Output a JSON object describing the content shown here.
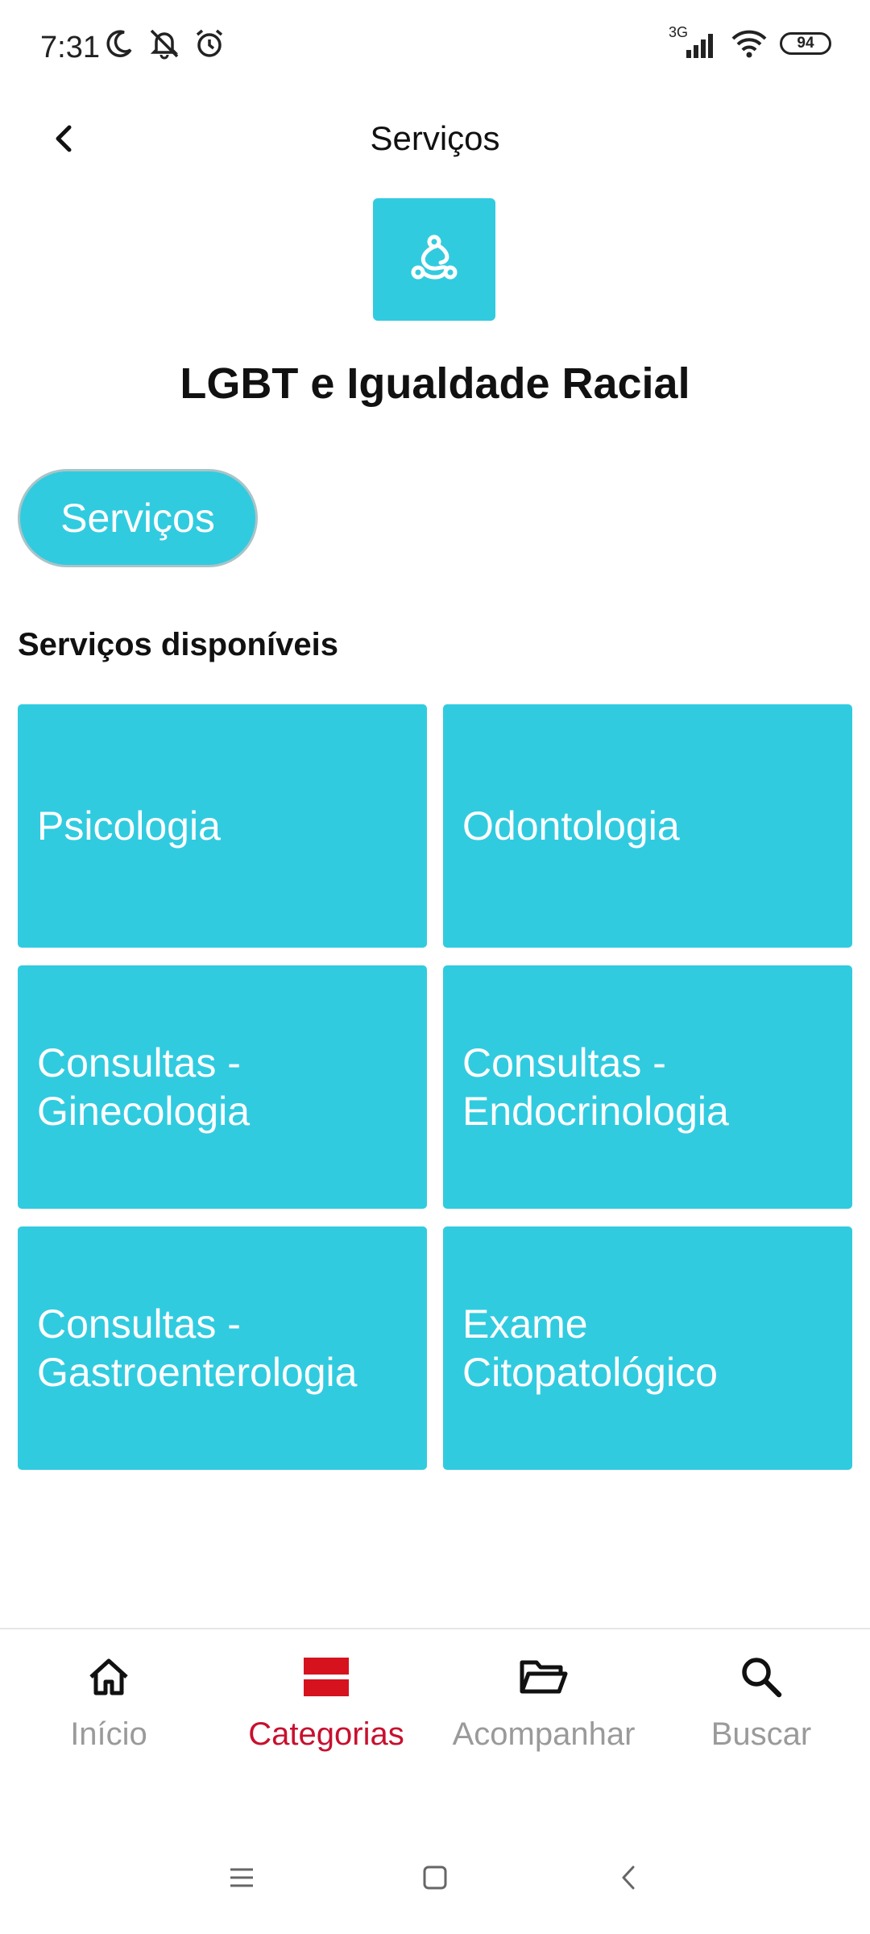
{
  "status_bar": {
    "time": "7:31",
    "network": "3G",
    "battery": "94",
    "icons": [
      "moon-icon",
      "bell-off-icon",
      "alarm-icon",
      "signal-icon",
      "wifi-icon",
      "battery-icon"
    ]
  },
  "header": {
    "title": "Serviços",
    "back_icon": "chevron-left-icon"
  },
  "category": {
    "title": "LGBT e Igualdade Racial",
    "icon": "diversity-icon",
    "accent_color": "#31cbe0"
  },
  "pill": {
    "label": "Serviços"
  },
  "services": {
    "section_title": "Serviços disponíveis",
    "items": [
      {
        "label": "Psicologia"
      },
      {
        "label": "Odontologia"
      },
      {
        "label": "Consultas - Ginecologia"
      },
      {
        "label": "Consultas - Endocrinologia"
      },
      {
        "label": "Consultas - Gastroenterologia"
      },
      {
        "label": "Exame Citopatológico"
      }
    ]
  },
  "bottom_nav": {
    "items": [
      {
        "label": "Início",
        "icon": "home-icon"
      },
      {
        "label": "Categorias",
        "icon": "categories-icon",
        "active": true,
        "active_color": "#c8102e"
      },
      {
        "label": "Acompanhar",
        "icon": "folder-icon"
      },
      {
        "label": "Buscar",
        "icon": "search-icon"
      }
    ]
  },
  "system_nav": {
    "icons": [
      "menu-icon",
      "home-square-icon",
      "back-icon"
    ]
  }
}
